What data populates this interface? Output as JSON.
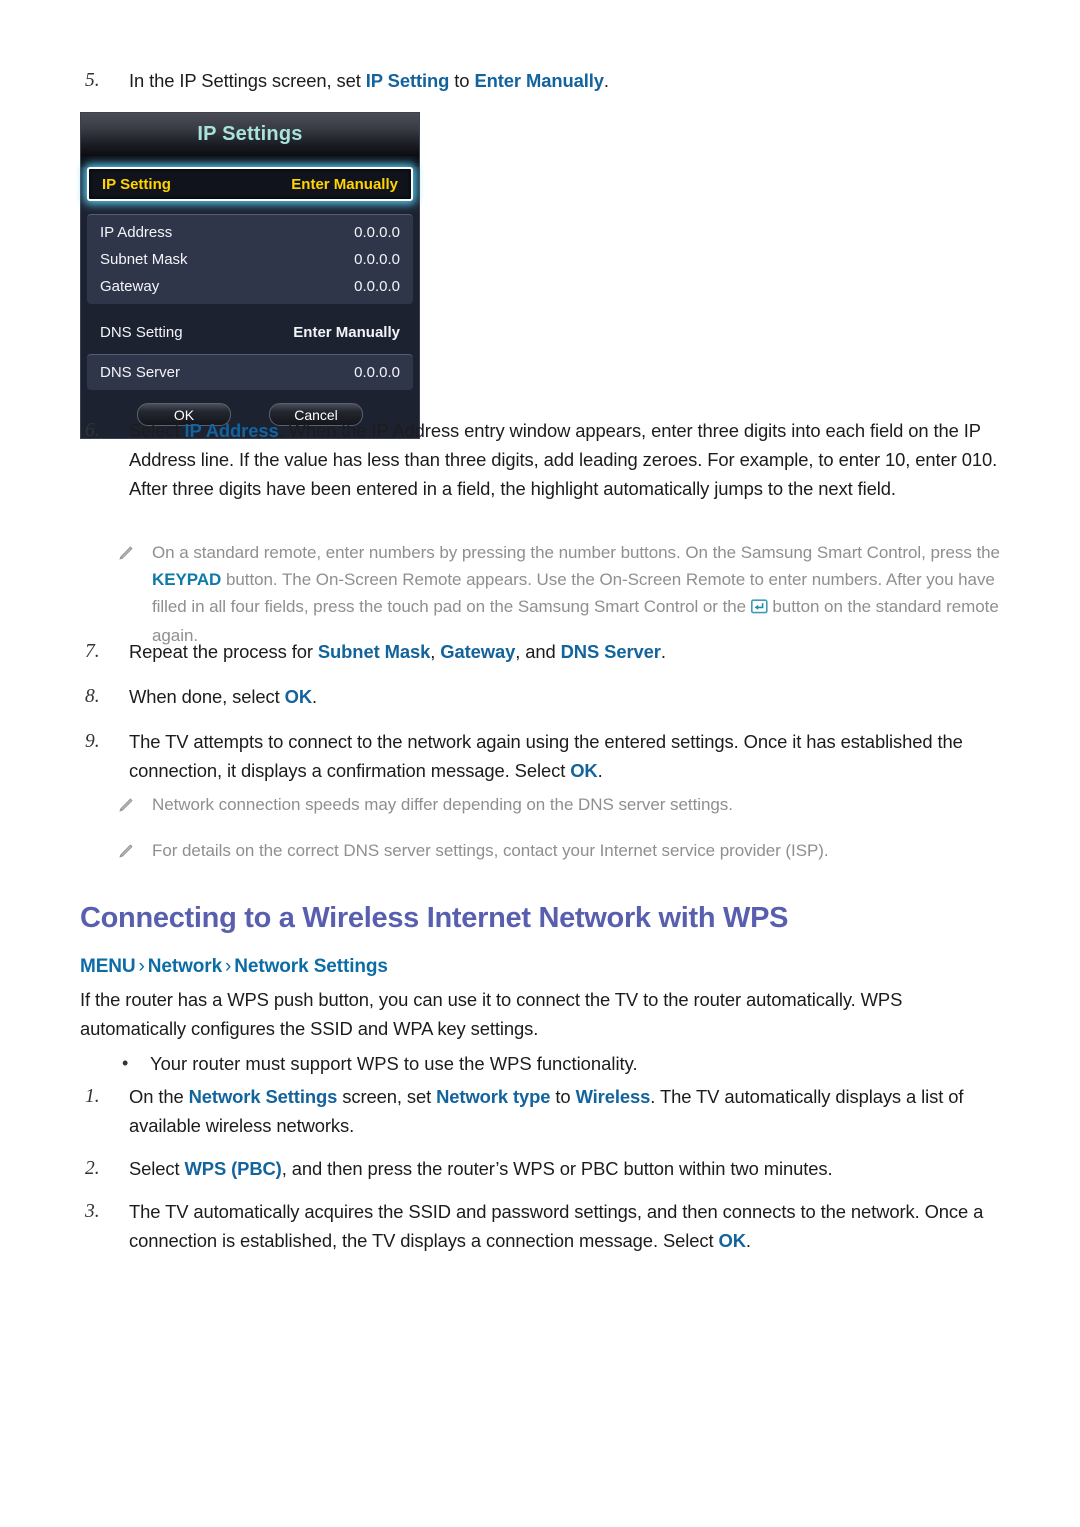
{
  "steps_ip": [
    {
      "num": "5.",
      "parts": [
        {
          "t": "In the IP Settings screen, set ",
          "s": "n"
        },
        {
          "t": "IP Setting",
          "s": "h"
        },
        {
          "t": " to ",
          "s": "n"
        },
        {
          "t": "Enter Manually",
          "s": "h"
        },
        {
          "t": ".",
          "s": "n"
        }
      ]
    },
    {
      "num": "6.",
      "parts": [
        {
          "t": "Select ",
          "s": "n"
        },
        {
          "t": "IP Address",
          "s": "h"
        },
        {
          "t": ". When the IP Address entry window appears, enter three digits into each field on the IP Address line. If the value has less than three digits, add leading zeroes. For example, to enter 10, enter 010. After three digits have been entered in a field, the highlight automatically jumps to the next field.",
          "s": "n"
        }
      ]
    },
    {
      "num": "7.",
      "parts": [
        {
          "t": "Repeat the process for ",
          "s": "n"
        },
        {
          "t": "Subnet Mask",
          "s": "h"
        },
        {
          "t": ", ",
          "s": "n"
        },
        {
          "t": "Gateway",
          "s": "h"
        },
        {
          "t": ", and ",
          "s": "n"
        },
        {
          "t": "DNS Server",
          "s": "h"
        },
        {
          "t": ".",
          "s": "n"
        }
      ]
    },
    {
      "num": "8.",
      "parts": [
        {
          "t": "When done, select ",
          "s": "n"
        },
        {
          "t": "OK",
          "s": "h"
        },
        {
          "t": ".",
          "s": "n"
        }
      ]
    },
    {
      "num": "9.",
      "parts": [
        {
          "t": "The TV attempts to connect to the network again using the entered settings. Once it has established the connection, it displays a confirmation message. Select ",
          "s": "n"
        },
        {
          "t": "OK",
          "s": "h"
        },
        {
          "t": ".",
          "s": "n"
        }
      ]
    }
  ],
  "note_keypad": {
    "parts": [
      {
        "t": "On a standard remote, enter numbers by pressing the number buttons. On the Samsung Smart Control, press the ",
        "s": "n"
      },
      {
        "t": "KEYPAD",
        "s": "h"
      },
      {
        "t": " button. The On-Screen Remote appears. Use the On-Screen Remote to enter numbers. After you have filled in all four fields, press the touch pad on the Samsung Smart Control or the ",
        "s": "n"
      },
      {
        "t": "[ENTER-ICON]",
        "s": "icon"
      },
      {
        "t": " button on the standard remote again.",
        "s": "n"
      }
    ]
  },
  "notes_dns": [
    "Network connection speeds may differ depending on the DNS server settings.",
    "For details on the correct DNS server settings, contact your Internet service provider (ISP)."
  ],
  "tv_panel": {
    "title": "IP Settings",
    "highlight_row": {
      "key": "IP Setting",
      "value": "Enter Manually"
    },
    "group_rows": [
      {
        "key": "IP Address",
        "value": "0.0.0.0"
      },
      {
        "key": "Subnet Mask",
        "value": "0.0.0.0"
      },
      {
        "key": "Gateway",
        "value": "0.0.0.0"
      }
    ],
    "dns_setting": {
      "key": "DNS Setting",
      "value": "Enter Manually"
    },
    "dns_server": {
      "key": "DNS Server",
      "value": "0.0.0.0"
    },
    "buttons": {
      "ok": "OK",
      "cancel": "Cancel"
    }
  },
  "section": {
    "title": "Connecting to a Wireless Internet Network with WPS",
    "breadcrumb": {
      "item1": "MENU",
      "sep1": "›",
      "item2": "Network",
      "sep2": "›",
      "item3": "Network Settings"
    },
    "intro": "If the router has a WPS push button, you can use it to connect the TV to the router automatically. WPS automatically configures the SSID and WPA key settings.",
    "bullet": "Your router must support WPS to use the WPS functionality."
  },
  "steps_wps": [
    {
      "num": "1.",
      "parts": [
        {
          "t": "On the ",
          "s": "n"
        },
        {
          "t": "Network Settings",
          "s": "h"
        },
        {
          "t": " screen, set ",
          "s": "n"
        },
        {
          "t": "Network type",
          "s": "h"
        },
        {
          "t": " to ",
          "s": "n"
        },
        {
          "t": "Wireless",
          "s": "h"
        },
        {
          "t": ". The TV automatically displays a list of available wireless networks.",
          "s": "n"
        }
      ]
    },
    {
      "num": "2.",
      "parts": [
        {
          "t": "Select ",
          "s": "n"
        },
        {
          "t": "WPS (PBC)",
          "s": "h"
        },
        {
          "t": ", and then press the router’s WPS or PBC button within two minutes.",
          "s": "n"
        }
      ]
    },
    {
      "num": "3.",
      "parts": [
        {
          "t": "The TV automatically acquires the SSID and password settings, and then connects to the network. Once a connection is established, the TV displays a connection message. Select ",
          "s": "n"
        },
        {
          "t": "OK",
          "s": "h"
        },
        {
          "t": ".",
          "s": "n"
        }
      ]
    }
  ],
  "colors": {
    "link_blue": "#13639d",
    "heading_purple": "#585fae",
    "breadcrumb_teal": "#0c6ca6",
    "note_gray": "#8f8f8f",
    "osd_title_mint": "#a9e4da",
    "osd_highlight_yellow": "#ffd400",
    "osd_glow_cyan": "#56c8ee"
  }
}
